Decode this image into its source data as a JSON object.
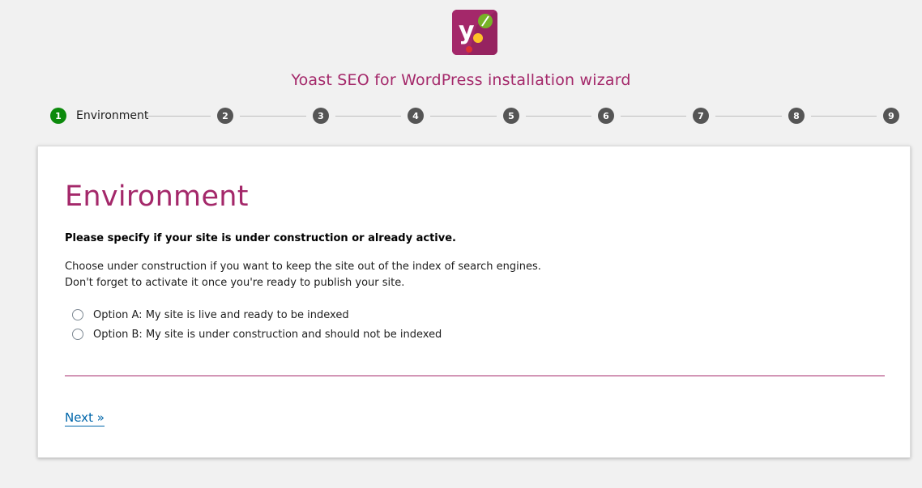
{
  "header": {
    "logo_icon": "yoast-logo-icon",
    "title": "Yoast SEO for WordPress installation wizard"
  },
  "colors": {
    "brand": "#a4286a",
    "active_step": "#0c8a0c",
    "inactive_step": "#555555",
    "link": "#0066aa"
  },
  "stepper": {
    "steps": [
      {
        "number": "1",
        "label": "Environment",
        "active": true
      },
      {
        "number": "2"
      },
      {
        "number": "3"
      },
      {
        "number": "4"
      },
      {
        "number": "5"
      },
      {
        "number": "6"
      },
      {
        "number": "7"
      },
      {
        "number": "8"
      },
      {
        "number": "9"
      }
    ]
  },
  "main": {
    "title": "Environment",
    "question": "Please specify if your site is under construction or already active.",
    "description_line1": "Choose under construction if you want to keep the site out of the index of search engines.",
    "description_line2": "Don't forget to activate it once you're ready to publish your site.",
    "options": [
      {
        "label": "Option A: My site is live and ready to be indexed",
        "checked": false
      },
      {
        "label": "Option B: My site is under construction and should not be indexed",
        "checked": false
      }
    ],
    "next_label": "Next »"
  }
}
